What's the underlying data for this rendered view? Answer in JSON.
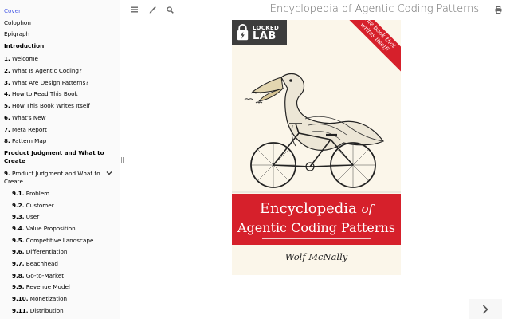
{
  "sidebar": {
    "items": [
      {
        "num": "",
        "label": "Cover",
        "kind": "active"
      },
      {
        "num": "",
        "label": "Colophon",
        "kind": "normal"
      },
      {
        "num": "",
        "label": "Epigraph",
        "kind": "normal"
      },
      {
        "num": "",
        "label": "Introduction",
        "kind": "part"
      },
      {
        "num": "1.",
        "label": "Welcome",
        "kind": "normal"
      },
      {
        "num": "2.",
        "label": "What Is Agentic Coding?",
        "kind": "normal"
      },
      {
        "num": "3.",
        "label": "What Are Design Patterns?",
        "kind": "normal"
      },
      {
        "num": "4.",
        "label": "How to Read This Book",
        "kind": "normal"
      },
      {
        "num": "5.",
        "label": "How This Book Writes Itself",
        "kind": "normal"
      },
      {
        "num": "6.",
        "label": "What's New",
        "kind": "normal"
      },
      {
        "num": "7.",
        "label": "Meta Report",
        "kind": "normal"
      },
      {
        "num": "8.",
        "label": "Pattern Map",
        "kind": "normal"
      },
      {
        "num": "",
        "label": "Product Judgment and What to Create",
        "kind": "part"
      },
      {
        "num": "9.",
        "label": "Product Judgment and What to Create",
        "kind": "expanded"
      },
      {
        "num": "9.1.",
        "label": "Problem",
        "kind": "sub"
      },
      {
        "num": "9.2.",
        "label": "Customer",
        "kind": "sub"
      },
      {
        "num": "9.3.",
        "label": "User",
        "kind": "sub"
      },
      {
        "num": "9.4.",
        "label": "Value Proposition",
        "kind": "sub"
      },
      {
        "num": "9.5.",
        "label": "Competitive Landscape",
        "kind": "sub"
      },
      {
        "num": "9.6.",
        "label": "Differentiation",
        "kind": "sub"
      },
      {
        "num": "9.7.",
        "label": "Beachhead",
        "kind": "sub"
      },
      {
        "num": "9.8.",
        "label": "Go-to-Market",
        "kind": "sub"
      },
      {
        "num": "9.9.",
        "label": "Revenue Model",
        "kind": "sub"
      },
      {
        "num": "9.10.",
        "label": "Monetization",
        "kind": "sub"
      },
      {
        "num": "9.11.",
        "label": "Distribution",
        "kind": "sub"
      }
    ]
  },
  "header": {
    "title": "Encyclopedia of Agentic Coding Patterns",
    "icons": [
      "menu-icon",
      "paintbrush-icon",
      "search-icon",
      "print-icon"
    ]
  },
  "cover": {
    "logo_line1": "LOCKED",
    "logo_line2": "LAB",
    "sash_line1": "The book that",
    "sash_line2": "writes itself!",
    "title_line1_a": "Encyclopedia",
    "title_line1_b": "of",
    "title_line2": "Agentic Coding Patterns",
    "author": "Wolf McNally",
    "colors": {
      "red": "#d6202b",
      "paper": "#fbf6ea",
      "logo_bg": "#3d3d3d"
    }
  },
  "nav": {
    "next_icon": "chevron-right-icon"
  },
  "colors": {
    "link_active": "#4a5ce6",
    "sidebar_bg": "#fafafa"
  }
}
